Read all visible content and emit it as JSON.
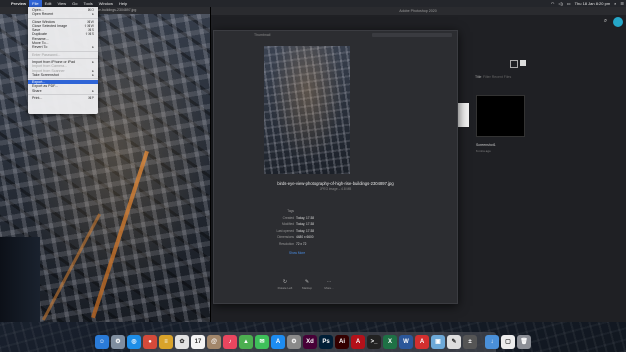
{
  "menubar": {
    "app_name": "Preview",
    "items": [
      "File",
      "Edit",
      "View",
      "Go",
      "Tools",
      "Window",
      "Help"
    ],
    "active_item": "File",
    "clock": "Thu 18 Jan 8:20 pm"
  },
  "photo_window": {
    "title": "aerial-of-high-rise-buildings-2304897.jpg"
  },
  "file_menu": {
    "items": [
      {
        "label": "Open...",
        "shortcut": "⌘O",
        "disabled": false
      },
      {
        "label": "Open Recent",
        "shortcut": "▸",
        "disabled": false
      },
      {
        "sep": true
      },
      {
        "label": "Close Window",
        "shortcut": "⌘W",
        "disabled": false
      },
      {
        "label": "Close Selected Image",
        "shortcut": "⇧⌘W",
        "disabled": false
      },
      {
        "label": "Save",
        "shortcut": "⌘S",
        "disabled": false
      },
      {
        "label": "Duplicate",
        "shortcut": "⇧⌘S",
        "disabled": false
      },
      {
        "label": "Rename...",
        "shortcut": "",
        "disabled": false
      },
      {
        "label": "Move To...",
        "shortcut": "",
        "disabled": false
      },
      {
        "label": "Revert To",
        "shortcut": "▸",
        "disabled": false
      },
      {
        "sep": true
      },
      {
        "label": "Enter Password...",
        "shortcut": "",
        "disabled": true
      },
      {
        "sep": true
      },
      {
        "label": "Import from iPhone or iPad",
        "shortcut": "▸",
        "disabled": false
      },
      {
        "label": "Import from Camera...",
        "shortcut": "",
        "disabled": true
      },
      {
        "label": "Import from Scanner",
        "shortcut": "▸",
        "disabled": true
      },
      {
        "label": "Take Screenshot",
        "shortcut": "▸",
        "disabled": false
      },
      {
        "sep": true
      },
      {
        "label": "Export...",
        "shortcut": "",
        "disabled": false,
        "selected": true
      },
      {
        "label": "Export as PDF...",
        "shortcut": "",
        "disabled": false
      },
      {
        "label": "Share",
        "shortcut": "▸",
        "disabled": false
      },
      {
        "sep": true
      },
      {
        "label": "Print...",
        "shortcut": "⌘P",
        "disabled": false
      }
    ]
  },
  "photos_window": {
    "title": "Adobe Photoshop 2020",
    "title_label": "Title",
    "filter_placeholder": "Filter Recent Files",
    "thumbnail": {
      "name": "Screenshot1",
      "meta": "6 mins ago"
    }
  },
  "info_panel": {
    "header": "Thumbnail",
    "filename": "birds-eye-view-photography-of-high-rise-buildings-2304897.jpg",
    "subtitle": "JPEG image – 4.8 MB",
    "rows": [
      {
        "key": "Tags",
        "value": ""
      },
      {
        "key": "Created",
        "value": "Today, 17:38"
      },
      {
        "key": "Modified",
        "value": "Today, 17:38"
      },
      {
        "key": "Last opened",
        "value": "Today, 17:38"
      },
      {
        "key": "Dimensions",
        "value": "4480 x 6600"
      },
      {
        "key": "Resolution",
        "value": "72 x 72"
      }
    ],
    "show_more": "Show More",
    "actions": [
      {
        "icon": "↻",
        "label": "Rotate Left"
      },
      {
        "icon": "✎",
        "label": "Markup"
      },
      {
        "icon": "⋯",
        "label": "More..."
      }
    ]
  },
  "dock": {
    "icons": [
      {
        "name": "finder",
        "glyph": "☺",
        "color": "#2a7bd8"
      },
      {
        "name": "launchpad",
        "glyph": "⚙",
        "color": "#7f8ea0"
      },
      {
        "name": "safari",
        "glyph": "◎",
        "color": "#1e8ee8"
      },
      {
        "name": "chrome",
        "glyph": "●",
        "color": "#d44a3a"
      },
      {
        "name": "notes",
        "glyph": "≡",
        "color": "#d9a32a"
      },
      {
        "name": "photos",
        "glyph": "✿",
        "color": "#e2e2e2"
      },
      {
        "name": "calendar",
        "glyph": "17",
        "color": "#f4f4f4"
      },
      {
        "name": "contacts",
        "glyph": "@",
        "color": "#a2866a"
      },
      {
        "name": "itunes",
        "glyph": "♪",
        "color": "#e9465f"
      },
      {
        "name": "maps",
        "glyph": "▲",
        "color": "#4caf50"
      },
      {
        "name": "messages",
        "glyph": "✉",
        "color": "#3ec05a"
      },
      {
        "name": "app-store",
        "glyph": "A",
        "color": "#1d8cf0"
      },
      {
        "name": "system-preferences",
        "glyph": "⚙",
        "color": "#8a8a8a"
      },
      {
        "name": "adobe-xd",
        "glyph": "Xd",
        "color": "#470137"
      },
      {
        "name": "photoshop",
        "glyph": "Ps",
        "color": "#001e36"
      },
      {
        "name": "illustrator",
        "glyph": "Ai",
        "color": "#330000"
      },
      {
        "name": "acrobat",
        "glyph": "A",
        "color": "#b3111a"
      },
      {
        "name": "terminal",
        "glyph": ">_",
        "color": "#222"
      },
      {
        "name": "excel",
        "glyph": "X",
        "color": "#1e7145"
      },
      {
        "name": "word",
        "glyph": "W",
        "color": "#2b579a"
      },
      {
        "name": "pdf-reader",
        "glyph": "A",
        "color": "#d32f2f"
      },
      {
        "name": "preview",
        "glyph": "▣",
        "color": "#6da9d8"
      },
      {
        "name": "textedit",
        "glyph": "✎",
        "color": "#dedede"
      },
      {
        "name": "calculator",
        "glyph": "±",
        "color": "#555"
      },
      {
        "name": "downloads",
        "glyph": "↓",
        "color": "#4a90d9"
      },
      {
        "name": "document",
        "glyph": "▢",
        "color": "#ececec"
      },
      {
        "name": "trash",
        "glyph": "🗑",
        "color": "#8c8f96"
      }
    ]
  }
}
